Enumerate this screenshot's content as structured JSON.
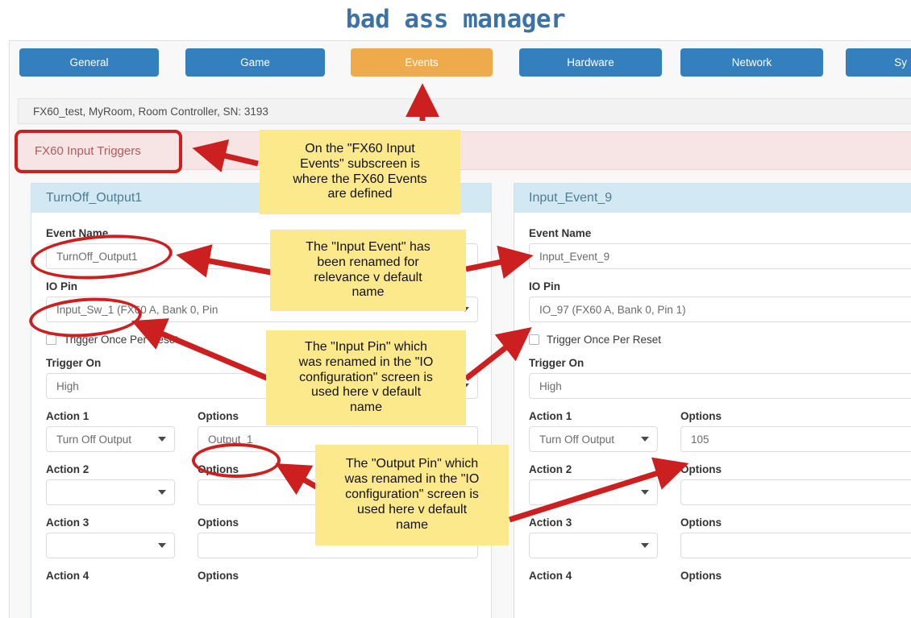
{
  "app": {
    "title": "bad Ass manager",
    "title_color": "#3d72a4"
  },
  "tabs": [
    {
      "label": "General",
      "active": false
    },
    {
      "label": "Game",
      "active": false
    },
    {
      "label": "Events",
      "active": true
    },
    {
      "label": "Hardware",
      "active": false
    },
    {
      "label": "Network",
      "active": false
    },
    {
      "label": "Sy",
      "active": false
    }
  ],
  "tab_colors": {
    "inactive": "#3480bf",
    "active": "#efab4b"
  },
  "breadcrumb": {
    "text": "FX60_test, MyRoom, Room Controller, SN: 3193"
  },
  "section_header": {
    "text": "FX60 Input Triggers",
    "bg": "#f7e4e4",
    "color": "#b05c5c"
  },
  "cards": [
    {
      "header": "TurnOff_Output1",
      "labels": {
        "event_name": "Event Name",
        "io_pin": "IO Pin",
        "trigger_once": "Trigger Once Per Reset",
        "trigger_on": "Trigger On",
        "action_1": "Action 1",
        "action_2": "Action 2",
        "action_3": "Action 3",
        "action_4": "Action 4",
        "options": "Options"
      },
      "values": {
        "event_name": "TurnOff_Output1",
        "io_pin": "Input_Sw_1 (FX60 A, Bank 0, Pin",
        "trigger_on": "High",
        "action_1": "Turn Off Output",
        "options_1": "Output_1",
        "action_2": "",
        "options_2": "",
        "action_3": "",
        "options_3": ""
      },
      "trigger_once_checked": false
    },
    {
      "header": "Input_Event_9",
      "labels": {
        "event_name": "Event Name",
        "io_pin": "IO Pin",
        "trigger_once": "Trigger Once Per Reset",
        "trigger_on": "Trigger On",
        "action_1": "Action 1",
        "action_2": "Action 2",
        "action_3": "Action 3",
        "action_4": "Action 4",
        "options": "Options"
      },
      "values": {
        "event_name": "Input_Event_9",
        "io_pin": "IO_97 (FX60 A, Bank 0, Pin 1)",
        "trigger_on": "High",
        "action_1": "Turn Off Output",
        "options_1": "105",
        "action_2": "",
        "options_2": "",
        "action_3": "",
        "options_3": ""
      },
      "trigger_once_checked": false
    }
  ],
  "annotations": {
    "color": "#cc2020",
    "note_bg": "#fbe98c",
    "notes": [
      {
        "text": "On the \"FX60 Input\nEvents\" subscreen is\nwhere the FX60 Events\nare defined"
      },
      {
        "text": "The \"Input Event\" has\nbeen renamed for\nrelevance v default\nname"
      },
      {
        "text": "The \"Input Pin\" which\nwas renamed in the \"IO\nconfiguration\" screen is\nused here v default\nname"
      },
      {
        "text": "The \"Output Pin\" which\nwas renamed in the \"IO\nconfiguration\" screen is\nused here v default\nname"
      }
    ]
  }
}
